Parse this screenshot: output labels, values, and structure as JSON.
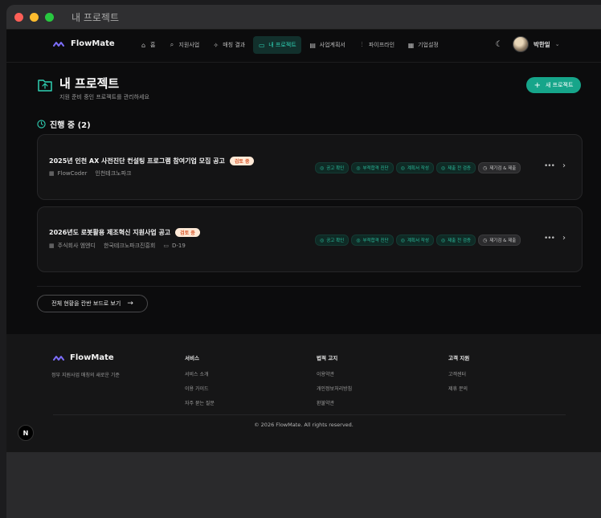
{
  "window": {
    "title": "내 프로젝트"
  },
  "navbar": {
    "brand": "FlowMate",
    "items": [
      {
        "label": "홈",
        "icon": "home-icon",
        "glyph": "⌂"
      },
      {
        "label": "지원사업",
        "icon": "search-icon",
        "glyph": "⌕"
      },
      {
        "label": "매칭 결과",
        "icon": "sparkle-icon",
        "glyph": "✧"
      },
      {
        "label": "내 프로젝트",
        "icon": "folder-icon",
        "glyph": "▭",
        "active": true
      },
      {
        "label": "사업계획서",
        "icon": "document-icon",
        "glyph": "▤"
      },
      {
        "label": "파이프라인",
        "icon": "pipeline-icon",
        "glyph": "⫶"
      },
      {
        "label": "기업설정",
        "icon": "building-icon",
        "glyph": "▦"
      }
    ],
    "user_name": "박한일"
  },
  "header": {
    "title": "내 프로젝트",
    "subtitle": "지원 준비 중인 프로젝트를 관리하세요",
    "new_button": "새 프로젝트"
  },
  "section": {
    "title": "진행 중 (2)"
  },
  "steps": [
    "공고 확인",
    "부적합격 진단",
    "계획서 작성",
    "제출 전 검증",
    "제기검 & 제출"
  ],
  "projects": [
    {
      "title": "2025년 인천 AX 사전진단 컨설팅 프로그램 참여기업 모집 공고",
      "badge": "검토 중",
      "company": "FlowCoder",
      "agency": "인천테크노파크",
      "deadline": ""
    },
    {
      "title": "2026년도 로봇활용 제조혁신 지원사업 공고",
      "badge": "검토 중",
      "company": "주식회사 엠엔디",
      "agency": "한국테크노파크진흥회",
      "deadline": "D-19"
    }
  ],
  "board_button": "전체 현황을 칸반 보드로 보기",
  "footer": {
    "brand": "FlowMate",
    "tagline": "정부 지원사업 매칭의 새로운 기준",
    "columns": [
      {
        "title": "서비스",
        "links": [
          "서비스 소개",
          "이용 가이드",
          "자주 묻는 질문"
        ]
      },
      {
        "title": "법적 고지",
        "links": [
          "이용약관",
          "개인정보처리방침",
          "환불약관"
        ]
      },
      {
        "title": "고객 지원",
        "links": [
          "고객센터",
          "제휴 문의"
        ]
      }
    ],
    "copyright": "© 2026 FlowMate. All rights reserved."
  },
  "colors": {
    "accent": "#16a58a",
    "accent_text": "#2fd1b4",
    "badge_bg": "#ffe9d6",
    "badge_text": "#d9582c"
  }
}
